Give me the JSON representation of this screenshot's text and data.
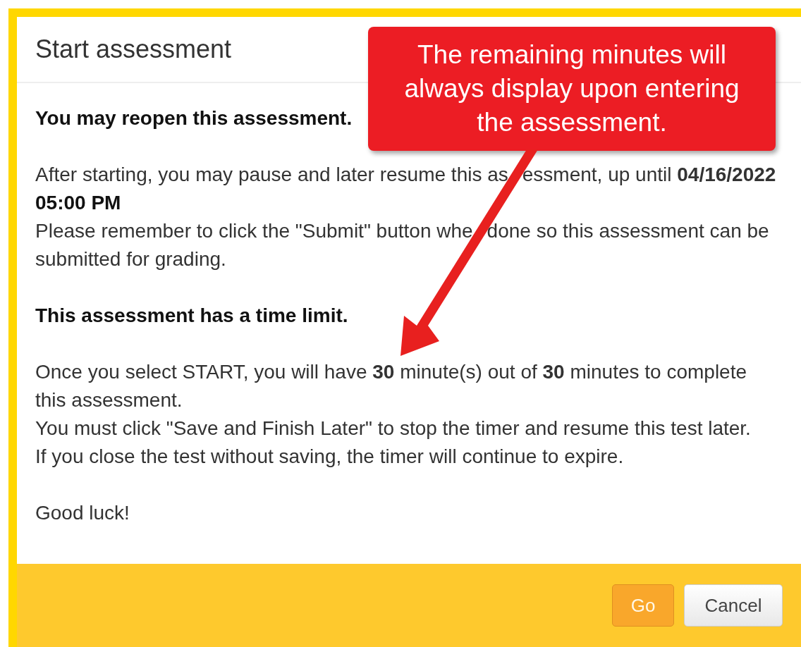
{
  "dialog": {
    "title": "Start assessment",
    "sections": [
      {
        "lines": [
          {
            "kind": "heading",
            "parts": [
              "You may reopen this assessment."
            ]
          }
        ]
      },
      {
        "lines": [
          {
            "kind": "text",
            "parts": [
              "After starting, you may pause and later resume this as",
              "essment, up until **04/16/2022**"
            ]
          },
          {
            "kind": "heading",
            "parts": [
              "05:00 PM"
            ]
          },
          {
            "kind": "text",
            "parts": [
              "Please remember to click the \"Submit\" button whe",
              "done so this assessment can be"
            ]
          },
          {
            "kind": "text",
            "parts": [
              "submitted for grading."
            ]
          }
        ]
      },
      {
        "lines": [
          {
            "kind": "heading",
            "parts": [
              "This assessment has a time limit."
            ]
          }
        ]
      },
      {
        "lines": [
          {
            "kind": "text",
            "parts": [
              "Once you select START, you will have **30** minute(s) out of **30** minutes to complete"
            ]
          },
          {
            "kind": "text",
            "parts": [
              "this assessment."
            ]
          },
          {
            "kind": "text",
            "parts": [
              "You must click \"Save and Finish Later\" to stop the timer and resume this test later."
            ]
          },
          {
            "kind": "text",
            "parts": [
              "If you close the test without saving, the timer will continue to expire."
            ]
          }
        ]
      },
      {
        "lines": [
          {
            "kind": "text",
            "parts": [
              "Good luck!"
            ]
          }
        ]
      }
    ],
    "buttons": [
      {
        "label": "Go",
        "kind": "primary"
      },
      {
        "label": "Cancel",
        "kind": "secondary"
      }
    ]
  },
  "callout": {
    "text": "The remaining minutes will always display upon entering the assessment."
  }
}
